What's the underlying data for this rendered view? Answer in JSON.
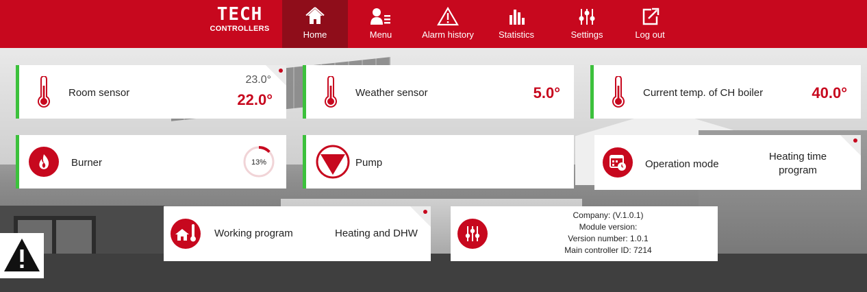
{
  "logo": {
    "line1": "TECH",
    "line2": "CONTROLLERS"
  },
  "nav": [
    {
      "label": "Home",
      "icon": "home-icon",
      "active": true
    },
    {
      "label": "Menu",
      "icon": "menu-user-icon"
    },
    {
      "label": "Alarm history",
      "icon": "alarm-triangle-icon"
    },
    {
      "label": "Statistics",
      "icon": "statistics-bars-icon"
    },
    {
      "label": "Settings",
      "icon": "settings-sliders-icon"
    },
    {
      "label": "Log out",
      "icon": "logout-icon"
    }
  ],
  "tiles": {
    "room_sensor": {
      "label": "Room sensor",
      "set_value": "23.0°",
      "current_value": "22.0°",
      "icon": "thermometer-icon"
    },
    "weather_sensor": {
      "label": "Weather sensor",
      "value": "5.0°",
      "icon": "thermometer-icon"
    },
    "ch_boiler": {
      "label": "Current temp. of CH boiler",
      "value": "40.0°",
      "icon": "thermometer-icon"
    },
    "burner": {
      "label": "Burner",
      "percent_text": "13%",
      "percent": 13,
      "icon": "flame-icon"
    },
    "pump": {
      "label": "Pump",
      "icon": "pump-triangle-icon"
    },
    "operation_mode": {
      "label": "Operation mode",
      "value_line1": "Heating time",
      "value_line2": "program",
      "icon": "calendar-clock-icon"
    },
    "working_program": {
      "label": "Working program",
      "value": "Heating and DHW",
      "icon": "house-thermometer-icon"
    },
    "info": {
      "line1": "Company: (V.1.0.1)",
      "line2": "Module version:",
      "line3": "Version number: 1.0.1",
      "line4": "Main controller ID: 7214",
      "icon": "settings-sliders-icon"
    }
  },
  "colors": {
    "brand_red": "#c7081e",
    "active_nav": "#8f0d1a",
    "status_green": "#3cc13c"
  }
}
